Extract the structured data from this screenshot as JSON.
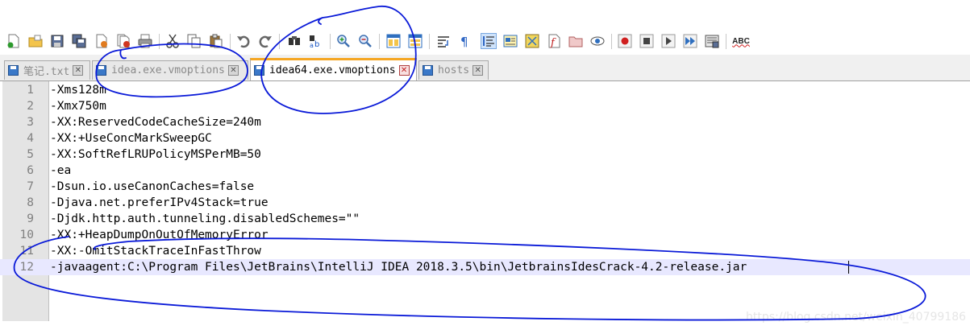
{
  "toolbar": {
    "buttons": [
      {
        "icon": "new-file-icon"
      },
      {
        "icon": "open-file-icon"
      },
      {
        "icon": "save-icon"
      },
      {
        "icon": "save-all-icon"
      },
      {
        "icon": "close-icon"
      },
      {
        "icon": "close-all-icon"
      },
      {
        "icon": "print-icon"
      },
      {
        "icon": "cut-icon"
      },
      {
        "icon": "copy-icon"
      },
      {
        "icon": "paste-icon"
      },
      {
        "icon": "undo-icon"
      },
      {
        "icon": "redo-icon"
      },
      {
        "icon": "find-icon"
      },
      {
        "icon": "replace-icon"
      },
      {
        "icon": "zoom-in-icon"
      },
      {
        "icon": "zoom-out-icon"
      },
      {
        "icon": "sync-vertical-icon"
      },
      {
        "icon": "sync-horizontal-icon"
      },
      {
        "icon": "word-wrap-icon"
      },
      {
        "icon": "show-all-characters-icon"
      },
      {
        "icon": "indent-guide-icon"
      },
      {
        "icon": "user-language-icon"
      },
      {
        "icon": "document-map-icon"
      },
      {
        "icon": "function-list-icon"
      },
      {
        "icon": "folder-as-workspace-icon"
      },
      {
        "icon": "monitoring-icon"
      },
      {
        "icon": "record-macro-icon"
      },
      {
        "icon": "stop-recording-icon"
      },
      {
        "icon": "playback-macro-icon"
      },
      {
        "icon": "run-macro-multiple-icon"
      },
      {
        "icon": "save-macro-icon"
      },
      {
        "icon": "spell-check-icon"
      }
    ],
    "spellcheck_label": "ABC"
  },
  "tabs": [
    {
      "label": "笔记.txt",
      "close": "✕",
      "active": false
    },
    {
      "label": "idea.exe.vmoptions",
      "close": "✕",
      "active": false
    },
    {
      "label": "idea64.exe.vmoptions",
      "close": "✕",
      "active": true
    },
    {
      "label": "hosts",
      "close": "✕",
      "active": false
    }
  ],
  "editor": {
    "lines": [
      {
        "num": "1",
        "text": "-Xms128m"
      },
      {
        "num": "2",
        "text": "-Xmx750m"
      },
      {
        "num": "3",
        "text": "-XX:ReservedCodeCacheSize=240m"
      },
      {
        "num": "4",
        "text": "-XX:+UseConcMarkSweepGC"
      },
      {
        "num": "5",
        "text": "-XX:SoftRefLRUPolicyMSPerMB=50"
      },
      {
        "num": "6",
        "text": "-ea"
      },
      {
        "num": "7",
        "text": "-Dsun.io.useCanonCaches=false"
      },
      {
        "num": "8",
        "text": "-Djava.net.preferIPv4Stack=true"
      },
      {
        "num": "9",
        "text": "-Djdk.http.auth.tunneling.disabledSchemes=\"\""
      },
      {
        "num": "10",
        "text": "-XX:+HeapDumpOnOutOfMemoryError"
      },
      {
        "num": "11",
        "text": "-XX:-OmitStackTraceInFastThrow"
      },
      {
        "num": "12",
        "text": "-javaagent:C:\\Program Files\\JetBrains\\IntelliJ IDEA 2018.3.5\\bin\\JetbrainsIdesCrack-4.2-release.jar"
      }
    ],
    "current_line": "12"
  },
  "watermark": "https://blog.csdn.net/weixin_40799186",
  "colors": {
    "active_tab_accent": "#f5a623",
    "annotation_ink": "#0a1ad8",
    "current_line_highlight": "#e8e8ff"
  }
}
